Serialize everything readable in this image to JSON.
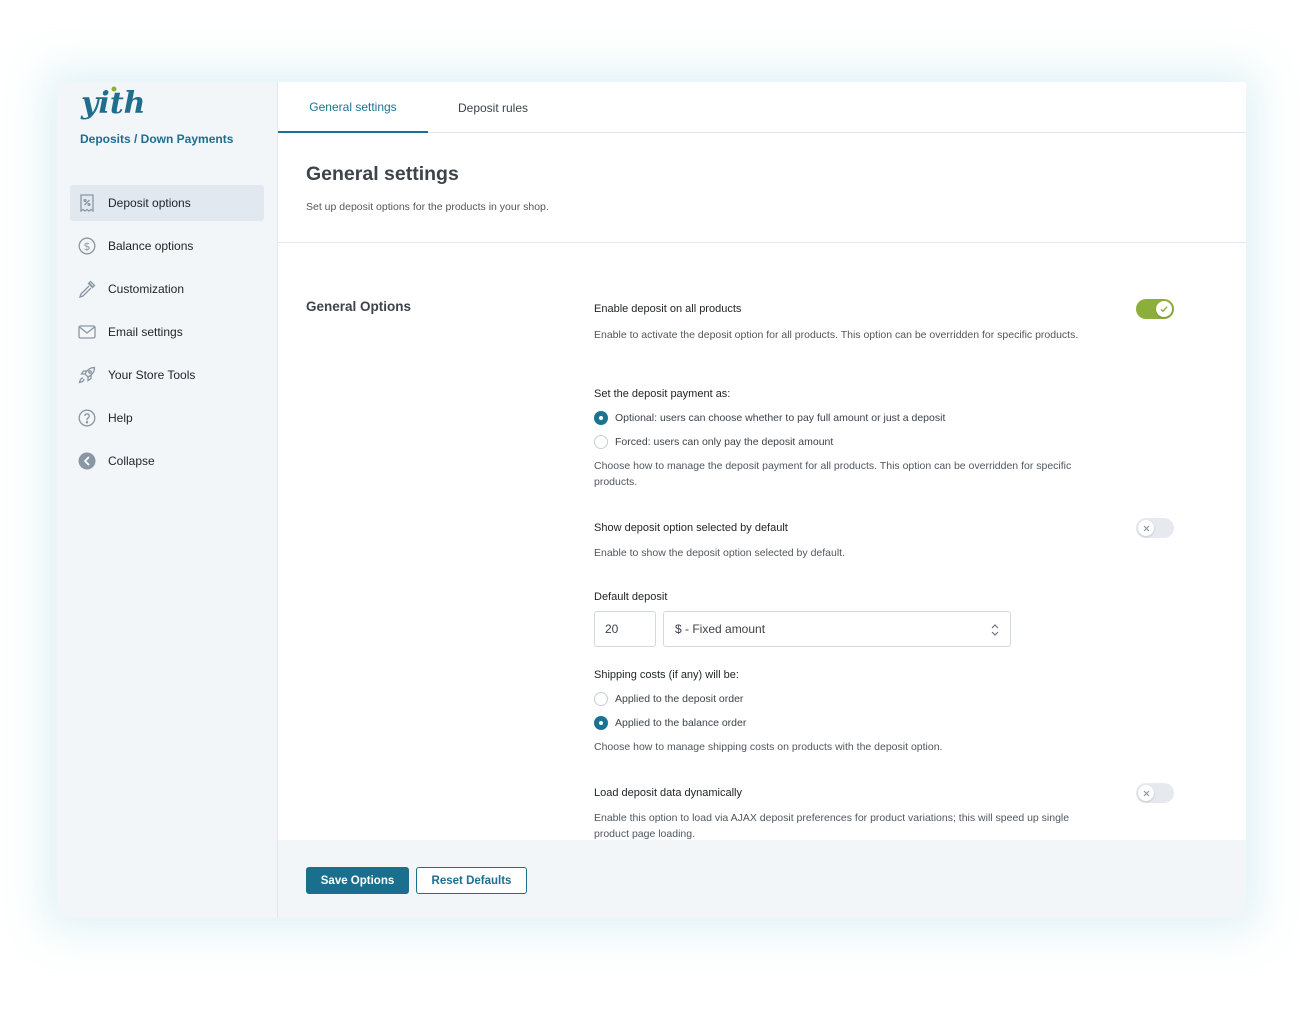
{
  "brand": {
    "logo_text": "yith",
    "plugin_name": "Deposits / Down Payments",
    "logo_color": "#1f6e8c",
    "accent_dot_color": "#8cae3a"
  },
  "sidebar": {
    "items": [
      {
        "label": "Deposit options",
        "icon": "receipt-percent-icon",
        "active": true
      },
      {
        "label": "Balance options",
        "icon": "dollar-circle-icon",
        "active": false
      },
      {
        "label": "Customization",
        "icon": "eyedropper-icon",
        "active": false
      },
      {
        "label": "Email settings",
        "icon": "envelope-icon",
        "active": false
      },
      {
        "label": "Your Store Tools",
        "icon": "rocket-icon",
        "active": false
      },
      {
        "label": "Help",
        "icon": "question-circle-icon",
        "active": false
      },
      {
        "label": "Collapse",
        "icon": "arrow-left-circle-icon",
        "active": false
      }
    ]
  },
  "tabs": [
    {
      "label": "General settings",
      "active": true
    },
    {
      "label": "Deposit rules",
      "active": false
    }
  ],
  "page": {
    "title": "General settings",
    "description": "Set up deposit options for the products in your shop."
  },
  "section": {
    "title": "General Options"
  },
  "options": {
    "enable_all": {
      "label": "Enable deposit on all products",
      "description": "Enable to activate the deposit option for all products. This option can be overridden for specific products.",
      "enabled": true
    },
    "payment_as": {
      "label": "Set the deposit payment as:",
      "choices": [
        {
          "label": "Optional: users can choose whether to pay full amount or just a deposit",
          "checked": true
        },
        {
          "label": "Forced: users can only pay the deposit amount",
          "checked": false
        }
      ],
      "description": "Choose how to manage the deposit payment for all products. This option can be overridden for specific products."
    },
    "selected_default": {
      "label": "Show deposit option selected by default",
      "description": "Enable to show the deposit option selected by default.",
      "enabled": false
    },
    "default_deposit": {
      "label": "Default deposit",
      "amount": "20",
      "type": "$ - Fixed amount"
    },
    "shipping": {
      "label": "Shipping costs (if any) will be:",
      "choices": [
        {
          "label": "Applied to the deposit order",
          "checked": false
        },
        {
          "label": "Applied to the balance order",
          "checked": true
        }
      ],
      "description": "Choose how to manage shipping costs on products with the deposit option."
    },
    "load_dynamic": {
      "label": "Load deposit data dynamically",
      "description": "Enable this option to load via AJAX deposit preferences for product variations; this will speed up single product page loading.",
      "enabled": false
    }
  },
  "footer": {
    "save_label": "Save Options",
    "reset_label": "Reset Defaults"
  },
  "colors": {
    "primary": "#1b6f8e",
    "toggle_on": "#8cae3a",
    "toggle_off": "#e6e9ed"
  }
}
